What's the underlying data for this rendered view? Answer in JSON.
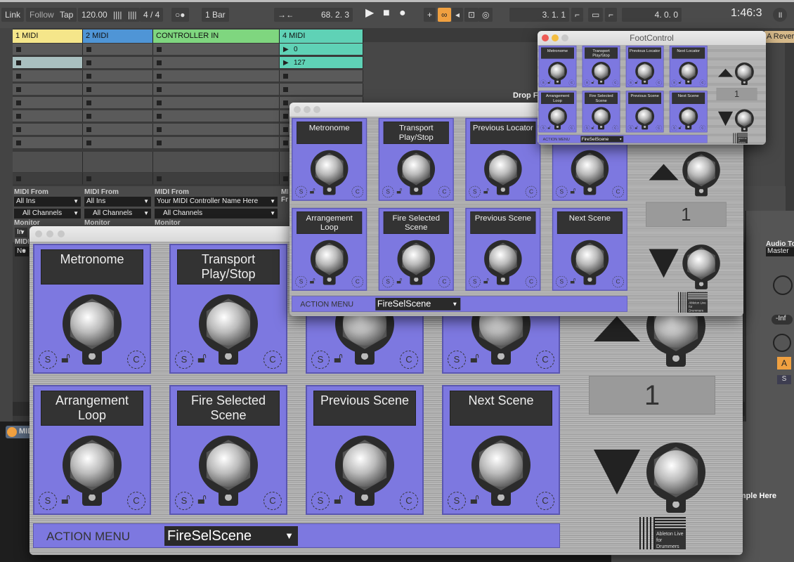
{
  "transport": {
    "link": "Link",
    "follow": "Follow",
    "tap": "Tap",
    "tempo": "120.00",
    "meter": "4 / 4",
    "metronome": "○●",
    "quantize": "1 Bar",
    "arr_position": "68.  2.  3",
    "loop_start": "3.  1.  1",
    "loop_length": "4.  0.  0",
    "time": "1:46:3"
  },
  "tracks": [
    {
      "name": "1 MIDI",
      "color": "#f5e68a"
    },
    {
      "name": "2 MIDI",
      "color": "#4f95d6"
    },
    {
      "name": "CONTROLLER IN",
      "color": "#7fd67f"
    },
    {
      "name": "4 MIDI",
      "color": "#5fd2b6"
    }
  ],
  "clips": [
    "0",
    "127"
  ],
  "io": {
    "midi_from_label": "MIDI From",
    "monitor_label": "Monitor",
    "midi_to_label": "MIDI To",
    "inputs": [
      "All Ins",
      "All Ins",
      "Your MIDI Controller Name Here"
    ],
    "channels": [
      "All Channels",
      "All Channels",
      "All Channels"
    ],
    "monitor_value": "In",
    "midi_to_value": "No"
  },
  "drop_hint": "Drop Files and Devices Here",
  "return_track": "A Reverb",
  "mixer": {
    "audio_to_label": "Audio To",
    "audio_to_value": "Master",
    "volume": "-Inf",
    "activator": "A",
    "solo": "S"
  },
  "device_drop_hint": "Drop an Instrument or Sample Here",
  "device_title": "MIDI",
  "footcontrol": {
    "title": "FootControl",
    "cards": [
      {
        "label": "Metronome"
      },
      {
        "label": "Transport Play/Stop"
      },
      {
        "label": "Previous Locator"
      },
      {
        "label": "Next Locator"
      },
      {
        "label": "Arrangement Loop"
      },
      {
        "label": "Fire Selected Scene"
      },
      {
        "label": "Previous Scene"
      },
      {
        "label": "Next Scene"
      }
    ],
    "solo_label": "S",
    "clear_label": "C",
    "display_value": "1",
    "action_menu_label": "ACTION MENU",
    "action_menu_value": "FireSelScene",
    "logo_text": "Ableton Live for Drummers",
    "card_color": "#7d78e0"
  }
}
